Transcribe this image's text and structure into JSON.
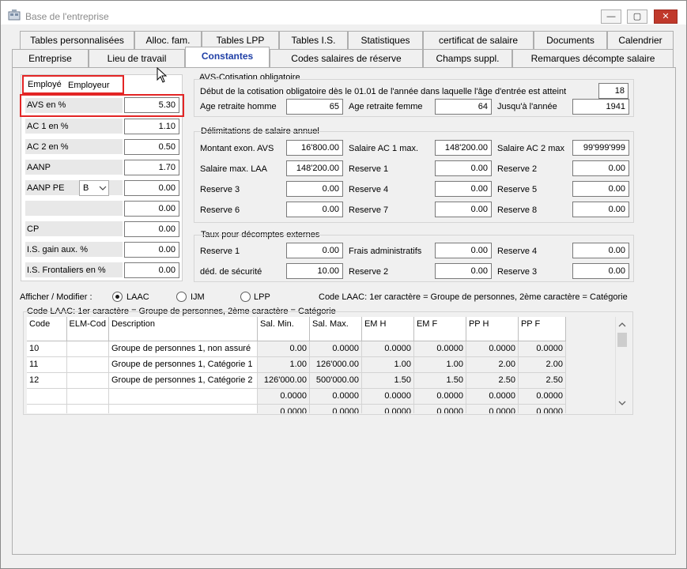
{
  "window": {
    "title": "Base de l'entreprise",
    "minimize": "—",
    "maximize": "▢",
    "close": "✕"
  },
  "tabs_row1": [
    "Tables personnalisées",
    "Alloc. fam.",
    "Tables LPP",
    "Tables I.S.",
    "Statistiques",
    "certificat de salaire",
    "Documents",
    "Calendrier"
  ],
  "tabs_row2": [
    "Entreprise",
    "Lieu de travail",
    "Constantes",
    "Codes salaires de réserve",
    "Champs suppl.",
    "Remarques décompte salaire"
  ],
  "left": {
    "subtab_employee": "Employé",
    "subtab_employer": "Employeur",
    "rows": [
      {
        "label": "AVS en %",
        "value": "5.30"
      },
      {
        "label": "AC 1 en %",
        "value": "1.10"
      },
      {
        "label": "AC 2 en %",
        "value": "0.50"
      },
      {
        "label": "AANP",
        "value": "1.70"
      },
      {
        "label": "AANP PE",
        "value": "0.00",
        "select": "B"
      },
      {
        "label": "",
        "value": "0.00"
      },
      {
        "label": "CP",
        "value": "0.00"
      },
      {
        "label": "I.S. gain aux. %",
        "value": "0.00"
      },
      {
        "label": "I.S. Frontaliers en %",
        "value": "0.00"
      }
    ]
  },
  "avs": {
    "title": "AVS-Cotisation obligatoire",
    "start_text": "Début de la cotisation obligatoire dès le 01.01 de l'année dans laquelle l'âge d'entrée est atteint",
    "start_value": "18",
    "retire_m_label": "Age retraite homme",
    "retire_m": "65",
    "retire_f_label": "Age retraite femme",
    "retire_f": "64",
    "until_label": "Jusqu'à l'année",
    "until": "1941"
  },
  "delim": {
    "title": "Délimitations de salaire annuel",
    "rows": [
      [
        [
          "Montant exon. AVS",
          "16'800.00"
        ],
        [
          "Salaire AC 1 max.",
          "148'200.00"
        ],
        [
          "Salaire AC 2 max",
          "99'999'999"
        ]
      ],
      [
        [
          "Salaire max. LAA",
          "148'200.00"
        ],
        [
          "Reserve 1",
          "0.00"
        ],
        [
          "Reserve 2",
          "0.00"
        ]
      ],
      [
        [
          "Reserve 3",
          "0.00"
        ],
        [
          "Reserve 4",
          "0.00"
        ],
        [
          "Reserve 5",
          "0.00"
        ]
      ],
      [
        [
          "Reserve 6",
          "0.00"
        ],
        [
          "Reserve 7",
          "0.00"
        ],
        [
          "Reserve 8",
          "0.00"
        ]
      ]
    ]
  },
  "taux": {
    "title": "Taux pour décomptes externes",
    "rows": [
      [
        [
          "Reserve 1",
          "0.00"
        ],
        [
          "Frais administratifs",
          "0.00"
        ],
        [
          "Reserve 4",
          "0.00"
        ]
      ],
      [
        [
          "déd. de sécurité",
          "10.00"
        ],
        [
          "Reserve 2",
          "0.00"
        ],
        [
          "Reserve 3",
          "0.00"
        ]
      ]
    ]
  },
  "afficher": {
    "label": "Afficher / Modifier :",
    "options": [
      "LAAC",
      "IJM",
      "LPP"
    ],
    "selected": "LAAC",
    "hint": "Code LAAC: 1er caractère = Groupe de personnes, 2ème caractère = Catégorie"
  },
  "table": {
    "group_title": "Code LAAC: 1er caractère = Groupe de personnes, 2ème caractère = Catégorie",
    "columns": [
      "Code",
      "ELM-Cod",
      "Description",
      "Sal. Min.",
      "Sal. Max.",
      "EM H",
      "EM F",
      "PP H",
      "PP F"
    ],
    "rows": [
      [
        "10",
        "",
        "Groupe de personnes 1, non assuré",
        "0.00",
        "0.0000",
        "0.0000",
        "0.0000",
        "0.0000",
        "0.0000"
      ],
      [
        "11",
        "",
        "Groupe de personnes 1, Catégorie 1",
        "1.00",
        "126'000.00",
        "1.00",
        "1.00",
        "2.00",
        "2.00"
      ],
      [
        "12",
        "",
        "Groupe de personnes 1, Catégorie 2",
        "126'000.00",
        "500'000.00",
        "1.50",
        "1.50",
        "2.50",
        "2.50"
      ],
      [
        "",
        "",
        "",
        "0.0000",
        "0.0000",
        "0.0000",
        "0.0000",
        "0.0000",
        "0.0000"
      ],
      [
        "",
        "",
        "",
        "0.0000",
        "0.0000",
        "0.0000",
        "0.0000",
        "0.0000",
        "0.0000"
      ]
    ]
  }
}
